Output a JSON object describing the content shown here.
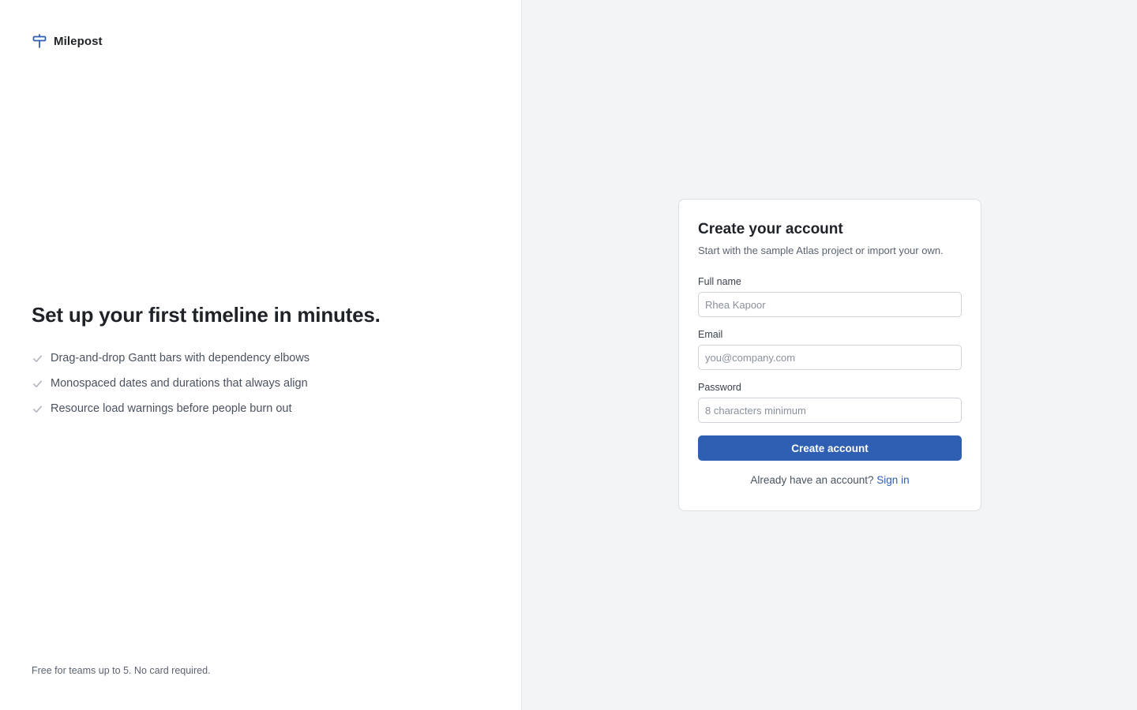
{
  "brand": {
    "name": "Milepost",
    "icon": "signpost-icon",
    "accent_color": "#2f5fb3"
  },
  "hero": {
    "title": "Set up your first timeline in minutes.",
    "features": [
      "Drag-and-drop Gantt bars with dependency elbows",
      "Monospaced dates and durations that always align",
      "Resource load warnings before people burn out"
    ]
  },
  "footnote": "Free for teams up to 5. No card required.",
  "signup": {
    "title": "Create your account",
    "subtitle": "Start with the sample Atlas project or import your own.",
    "fields": {
      "full_name": {
        "label": "Full name",
        "placeholder": "Rhea Kapoor",
        "value": ""
      },
      "email": {
        "label": "Email",
        "placeholder": "you@company.com",
        "value": ""
      },
      "password": {
        "label": "Password",
        "placeholder": "8 characters minimum",
        "value": ""
      }
    },
    "submit_label": "Create account",
    "signin_prompt": "Already have an account?",
    "signin_link": "Sign in"
  }
}
